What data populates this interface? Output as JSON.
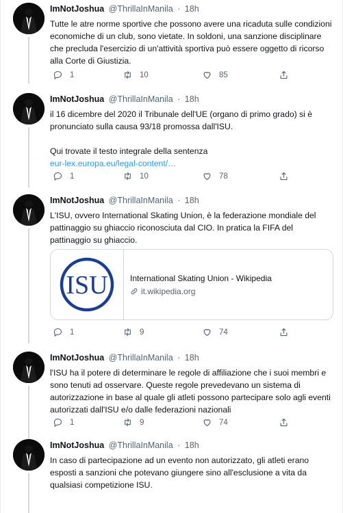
{
  "user": {
    "name": "ImNotJoshua",
    "handle": "@ThrillaInManila",
    "time": "18h"
  },
  "tweets": [
    {
      "text": "Tutte le atre norme sportive che possono avere una ricaduta sulle condizioni economiche di un club, sono vietate. In soldoni, una sanzione disciplinare che precluda l'esercizio di un'attività sportiva può essere oggetto di ricorso alla Corte di Giustizia.",
      "replies": "1",
      "retweets": "10",
      "likes": "85"
    },
    {
      "text": "il 16 dicembre del 2020 il Tribunale dell'UE (organo di primo grado) si è pronunciato sulla causa 93/18 promossa dall'ISU.",
      "text2": "Qui trovate il testo integrale della sentenza",
      "link": "eur-lex.europa.eu/legal-content/…",
      "replies": "1",
      "retweets": "10",
      "likes": "78"
    },
    {
      "text": "L'ISU, ovvero International Skating Union, è la federazione mondiale del pattinaggio su ghiaccio riconosciuta dal CIO. In pratica la FIFA del pattinaggio su ghiaccio.",
      "card": {
        "logo_text": "ISU",
        "title": "International Skating Union - Wikipedia",
        "domain": "it.wikipedia.org"
      },
      "replies": "1",
      "retweets": "9",
      "likes": "74"
    },
    {
      "text": "l'ISU ha il potere di determinare le regole di affiliazione che i suoi membri e sono tenuti ad osservare. Queste regole prevedevano un sistema di autorizzazione in base al quale gli atleti possono partecipare solo agli eventi autorizzati dall'ISU e/o dalle federazioni nazionali",
      "replies": "1",
      "retweets": "9",
      "likes": "74"
    },
    {
      "text": "In caso di partecipazione ad un evento non autorizzato, gli atleti erano esposti a sanzioni che potevano giungere sino all'esclusione a vita da qualsiasi competizione ISU."
    }
  ],
  "colors": {
    "link": "#1d9bf0",
    "meta": "#536471",
    "isu_blue": "#1a3f8f"
  },
  "icons": [
    "reply-icon",
    "retweet-icon",
    "like-icon",
    "share-icon",
    "link-icon"
  ]
}
